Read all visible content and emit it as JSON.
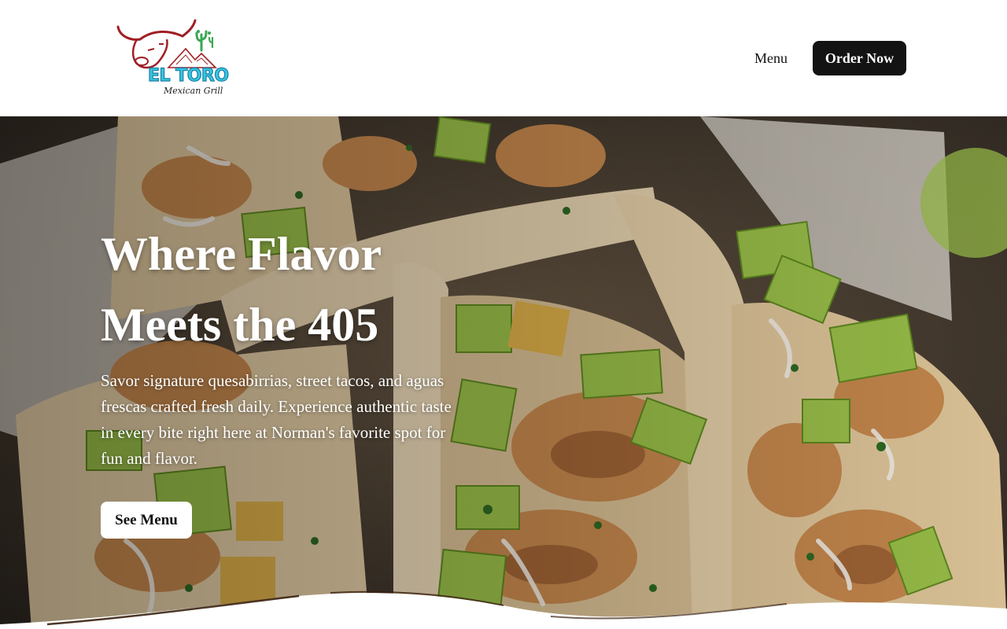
{
  "header": {
    "logo": {
      "brand": "EL TORO",
      "tagline": "Mexican Grill",
      "icon": "bull-head-icon"
    },
    "nav": {
      "menu_label": "Menu",
      "order_label": "Order Now"
    }
  },
  "hero": {
    "title_line1": "Where Flavor",
    "title_line2": "Meets the 405",
    "description": "Savor signature quesabirrias, street tacos, and aguas frescas crafted fresh daily. Experience authentic taste in every bite right here at Norman's favorite spot for fun and flavor.",
    "cta_label": "See Menu",
    "background": "shrimp-tacos-image"
  },
  "colors": {
    "brand_red": "#a01f24",
    "brand_cyan": "#36c6de",
    "button_dark": "#131313",
    "button_light": "#ffffff"
  }
}
